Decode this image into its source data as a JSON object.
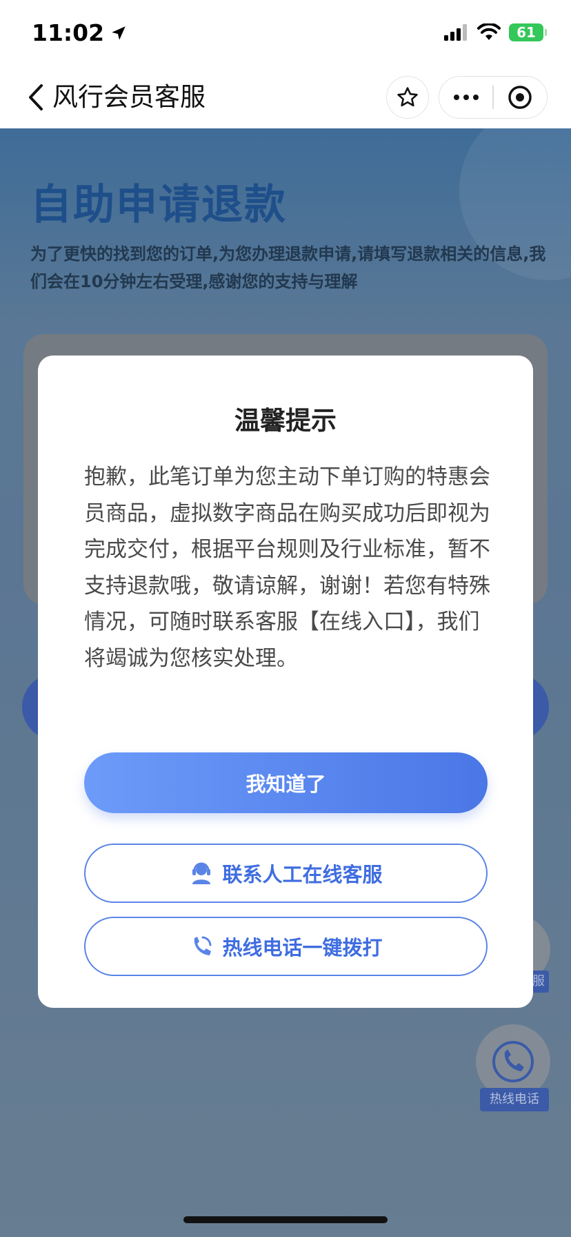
{
  "status_bar": {
    "time": "11:02",
    "battery": "61"
  },
  "nav": {
    "title": "风行会员客服"
  },
  "page": {
    "heading": "自助申请退款",
    "description": "为了更快的找到您的订单,为您办理退款申请,请填写退款相关的信息,我们会在10分钟左右受理,感谢您的支持与理解",
    "float_service_label": "服",
    "float_hotline_label": "热线电话"
  },
  "modal": {
    "title": "温馨提示",
    "body": "抱歉，此笔订单为您主动下单订购的特惠会员商品，虚拟数字商品在购买成功后即视为完成交付，根据平台规则及行业标准，暂不支持退款哦，敬请谅解，谢谢！若您有特殊情况，可随时联系客服【在线入口】，我们将竭诚为您核实处理。",
    "confirm_label": "我知道了",
    "service_label": "联系人工在线客服",
    "hotline_label": "热线电话一键拨打"
  },
  "colors": {
    "primary": "#4a77e6",
    "primary_light": "#6c9bf9",
    "overlay_bg": "#5b7592",
    "battery": "#34c759"
  },
  "icons": [
    "location-arrow-icon",
    "signal-icon",
    "wifi-icon",
    "battery-icon",
    "back-arrow-icon",
    "star-icon",
    "more-icon",
    "close-target-icon",
    "customer-service-icon",
    "phone-icon"
  ]
}
